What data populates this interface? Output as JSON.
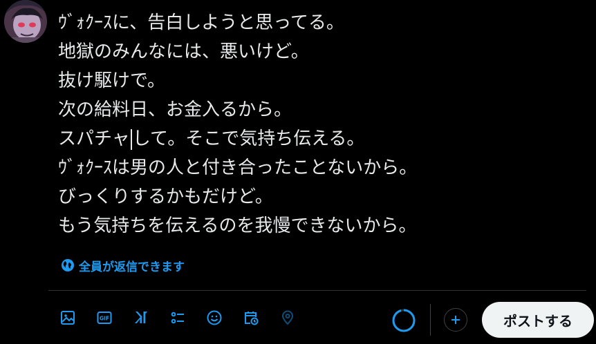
{
  "avatar": {
    "icon": "user-avatar"
  },
  "editor": {
    "lines": [
      "ｳﾞｫｸｰｽに、告白しようと思ってる。",
      "地獄のみんなには、悪いけど。",
      "抜け駆けで。",
      "次の給料日、お金入るから。",
      "スパチャ",
      "して。そこで気持ち伝える。",
      "ｳﾞｫｸｰｽは男の人と付き合ったことないから。",
      "びっくりするかもだけど。",
      "もう気持ちを伝えるのを我慢できないから。"
    ]
  },
  "reply_setting": {
    "label": "全員が返信できます",
    "icon": "globe-icon"
  },
  "toolbar": {
    "icons": [
      "image-icon",
      "gif-icon",
      "grok-icon",
      "poll-icon",
      "emoji-icon",
      "schedule-icon",
      "location-icon"
    ],
    "gif_label": "GIF"
  },
  "composer_actions": {
    "post_label": "ポストする",
    "add_icon": "plus-icon"
  },
  "colors": {
    "accent": "#1d9bf0",
    "background": "#000000",
    "text": "#e7e9ea",
    "post_button_bg": "#eff3f4"
  }
}
